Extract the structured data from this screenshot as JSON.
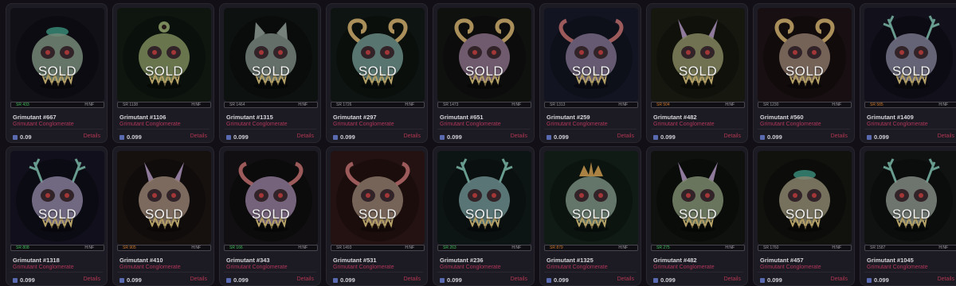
{
  "overlay_label": "SOLD",
  "details_label": "Details",
  "rarity_tag": "H:NF",
  "cards": [
    {
      "name": "Grimutant #667",
      "collection": "Grimutant Conglomerate",
      "price": "0.09",
      "sr": "SR 433",
      "sr_color": "#3fbf5a",
      "palette": "#8aa08c",
      "bg": "#15131c",
      "horn": "none"
    },
    {
      "name": "Grimutant #1106",
      "collection": "Grimutant Conglomerate",
      "price": "0.099",
      "sr": "SR 1138",
      "sr_color": "#9a96a0",
      "palette": "#8fa06a",
      "bg": "#111a12",
      "horn": "eye"
    },
    {
      "name": "Grimutant #1315",
      "collection": "Grimutant Conglomerate",
      "price": "0.099",
      "sr": "SR 1464",
      "sr_color": "#9a96a0",
      "palette": "#8a9890",
      "bg": "#101412",
      "horn": "cat"
    },
    {
      "name": "Grimutant #297",
      "collection": "Grimutant Conglomerate",
      "price": "0.099",
      "sr": "SR 1726",
      "sr_color": "#9a96a0",
      "palette": "#7aa098",
      "bg": "#101815",
      "horn": "ram"
    },
    {
      "name": "Grimutant #651",
      "collection": "Grimutant Conglomerate",
      "price": "0.099",
      "sr": "SR 1473",
      "sr_color": "#9a96a0",
      "palette": "#9a7a98",
      "bg": "#121412",
      "horn": "ram"
    },
    {
      "name": "Grimutant #259",
      "collection": "Grimutant Conglomerate",
      "price": "0.099",
      "sr": "SR 1313",
      "sr_color": "#9a96a0",
      "palette": "#8a7a98",
      "bg": "#161828",
      "horn": "curl"
    },
    {
      "name": "Grimutant #482",
      "collection": "Grimutant Conglomerate",
      "price": "0.099",
      "sr": "SR 504",
      "sr_color": "#d07a2a",
      "palette": "#9a9a70",
      "bg": "#1a1c12",
      "horn": "spike"
    },
    {
      "name": "Grimutant #560",
      "collection": "Grimutant Conglomerate",
      "price": "0.099",
      "sr": "SR 1230",
      "sr_color": "#9a96a0",
      "palette": "#a08878",
      "bg": "#1c1214",
      "horn": "ram"
    },
    {
      "name": "Grimutant #1409",
      "collection": "Grimutant Conglomerate",
      "price": "0.099",
      "sr": "SR 585",
      "sr_color": "#d07a2a",
      "palette": "#8a88a0",
      "bg": "#151320",
      "horn": "antler"
    },
    {
      "name": "Grimutant #1318",
      "collection": "Grimutant Conglomerate",
      "price": "0.099",
      "sr": "SR 808",
      "sr_color": "#3fbf5a",
      "palette": "#9a90b0",
      "bg": "#131220",
      "horn": "antler"
    },
    {
      "name": "Grimutant #410",
      "collection": "Grimutant Conglomerate",
      "price": "0.099",
      "sr": "SR 905",
      "sr_color": "#d07a2a",
      "palette": "#a89080",
      "bg": "#1a1412",
      "horn": "spike"
    },
    {
      "name": "Grimutant #343",
      "collection": "Grimutant Conglomerate",
      "price": "0.099",
      "sr": "SR 166",
      "sr_color": "#3fbf5a",
      "palette": "#a088a8",
      "bg": "#141214",
      "horn": "curl"
    },
    {
      "name": "Grimutant #531",
      "collection": "Grimutant Conglomerate",
      "price": "0.099",
      "sr": "SR 1493",
      "sr_color": "#9a96a0",
      "palette": "#a08878",
      "bg": "#2a1614",
      "horn": "curl"
    },
    {
      "name": "Grimutant #236",
      "collection": "Grimutant Conglomerate",
      "price": "0.099",
      "sr": "SR 263",
      "sr_color": "#3fbf5a",
      "palette": "#7aa0a0",
      "bg": "#101818",
      "horn": "antler"
    },
    {
      "name": "Grimutant #1325",
      "collection": "Grimutant Conglomerate",
      "price": "0.099",
      "sr": "SR 879",
      "sr_color": "#d07a2a",
      "palette": "#8aa090",
      "bg": "#122018",
      "horn": "crown"
    },
    {
      "name": "Grimutant #482",
      "collection": "Grimutant Conglomerate",
      "price": "0.099",
      "sr": "SR 275",
      "sr_color": "#3fbf5a",
      "palette": "#90a080",
      "bg": "#111410",
      "horn": "spike"
    },
    {
      "name": "Grimutant #457",
      "collection": "Grimutant Conglomerate",
      "price": "0.099",
      "sr": "SR 1760",
      "sr_color": "#9a96a0",
      "palette": "#a09a80",
      "bg": "#141410",
      "horn": "none"
    },
    {
      "name": "Grimutant #1045",
      "collection": "Grimutant Conglomerate",
      "price": "0.099",
      "sr": "SR 1587",
      "sr_color": "#9a96a0",
      "palette": "#98a098",
      "bg": "#121614",
      "horn": "antler"
    }
  ]
}
